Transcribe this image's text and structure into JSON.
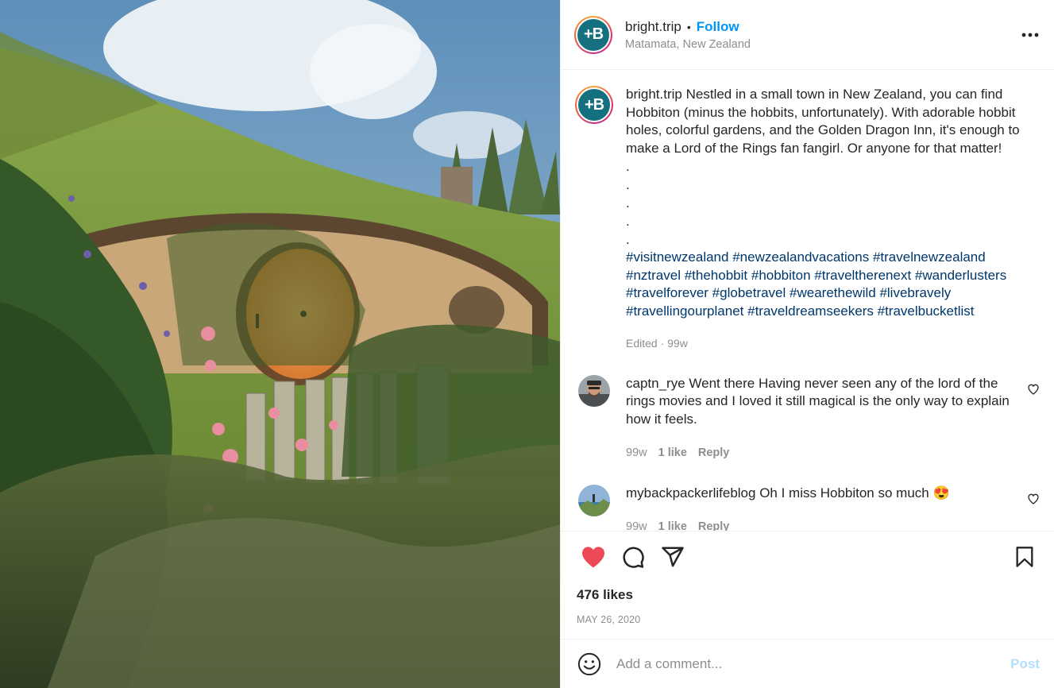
{
  "post": {
    "username": "bright.trip",
    "avatar_letter": "+B",
    "follow_label": "Follow",
    "separator": "•",
    "location": "Matamata, New Zealand",
    "more_icon": "more-horizontal-icon"
  },
  "caption": {
    "username": "bright.trip",
    "text": "Nestled in a small town in New Zealand, you can find Hobbiton (minus the hobbits, unfortunately). With adorable hobbit holes, colorful gardens, and the Golden Dragon Inn, it's enough to make a Lord of the Rings fan fangirl. Or anyone for that matter!",
    "dots": [
      ".",
      ".",
      ".",
      ".",
      "."
    ],
    "hashtags": [
      "#visitnewzealand",
      "#newzealandvacations",
      "#travelnewzealand",
      "#nztravel",
      "#thehobbit",
      "#hobbiton",
      "#traveltherenext",
      "#wanderlusters",
      "#travelforever",
      "#globetravel",
      "#wearethewild",
      "#livebravely",
      "#travellingourplanet",
      "#traveldreamseekers",
      "#travelbucketlist"
    ],
    "meta": "Edited · 99w"
  },
  "comments": [
    {
      "username": "captn_rye",
      "text": "Went there Having never seen any of the lord of the rings movies and I loved it still magical is the only way to explain how it feels.",
      "time": "99w",
      "likes": "1 like",
      "reply": "Reply"
    },
    {
      "username": "mybackpackerlifeblog",
      "text": "Oh I miss Hobbiton so much 😍",
      "time": "99w",
      "likes": "1 like",
      "reply": "Reply"
    }
  ],
  "actions": {
    "like_icon": "heart-filled-icon",
    "comment_icon": "comment-icon",
    "share_icon": "share-icon",
    "save_icon": "bookmark-icon",
    "like_color": "#ed4956"
  },
  "likes_count": "476 likes",
  "date": "MAY 26, 2020",
  "add_comment": {
    "placeholder": "Add a comment...",
    "post_label": "Post",
    "emoji_icon": "smiley-icon"
  },
  "colors": {
    "link_blue": "#0095f6",
    "hashtag": "#00376b",
    "muted": "#8e8e8e",
    "brand_avatar": "#14707e"
  }
}
